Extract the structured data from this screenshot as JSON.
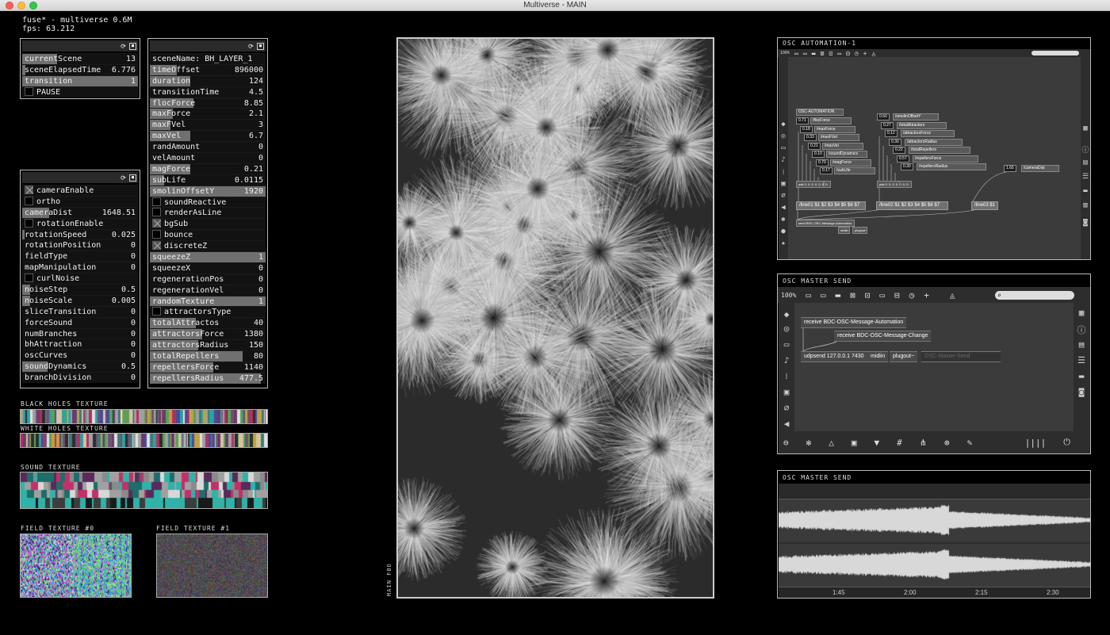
{
  "window": {
    "title": "Multiverse - MAIN"
  },
  "info": {
    "line1": "fuse* - multiverse 0.6M",
    "line2": "fps: 63.212"
  },
  "panel_scene": {
    "rows": [
      {
        "label": "currentScene",
        "value": "13",
        "fill": 0.3
      },
      {
        "label": "sceneElapsedTime",
        "value": "6.776",
        "fill": 0.03
      },
      {
        "label": "transition",
        "value": "1",
        "fill": 1.0
      }
    ],
    "toggle_pause": {
      "label": "PAUSE",
      "on": false
    }
  },
  "panel_layer": {
    "scene_name": "sceneName: BH_LAYER_1",
    "rows": [
      {
        "type": "slider",
        "label": "timeOffset",
        "value": "896000",
        "fill": 0.23
      },
      {
        "type": "slider",
        "label": "duration",
        "value": "124",
        "fill": 0.35
      },
      {
        "type": "slider",
        "label": "transitionTime",
        "value": "4.5",
        "fill": 0.0
      },
      {
        "type": "slider",
        "label": "flocForce",
        "value": "8.85",
        "fill": 0.38
      },
      {
        "type": "slider",
        "label": "maxForce",
        "value": "2.1",
        "fill": 0.2
      },
      {
        "type": "slider",
        "label": "maxFVel",
        "value": "3",
        "fill": 0.18
      },
      {
        "type": "slider",
        "label": "maxVel",
        "value": "6.7",
        "fill": 0.35
      },
      {
        "type": "slider",
        "label": "randAmount",
        "value": "0",
        "fill": 0.0
      },
      {
        "type": "slider",
        "label": "velAmount",
        "value": "0",
        "fill": 0.0
      },
      {
        "type": "slider",
        "label": "magForce",
        "value": "0.21",
        "fill": 0.35
      },
      {
        "type": "slider",
        "label": "subLife",
        "value": "0.0115",
        "fill": 0.12
      },
      {
        "type": "slider",
        "label": "smolinOffsetY",
        "value": "1920",
        "fill": 1.0
      },
      {
        "type": "toggle",
        "label": "soundReactive",
        "on": false
      },
      {
        "type": "toggle",
        "label": "renderAsLine",
        "on": false
      },
      {
        "type": "toggle",
        "label": "bgSub",
        "on": true
      },
      {
        "type": "toggle",
        "label": "bounce",
        "on": false
      },
      {
        "type": "toggle",
        "label": "discreteZ",
        "on": true
      },
      {
        "type": "slider",
        "label": "squeezeZ",
        "value": "1",
        "fill": 1.0
      },
      {
        "type": "slider",
        "label": "squeezeX",
        "value": "0",
        "fill": 0.0
      },
      {
        "type": "slider",
        "label": "regenerationPos",
        "value": "0",
        "fill": 0.0
      },
      {
        "type": "slider",
        "label": "regenerationVel",
        "value": "0",
        "fill": 0.0
      },
      {
        "type": "slider",
        "label": "randomTexture",
        "value": "1",
        "fill": 1.0
      },
      {
        "type": "toggle",
        "label": "attractorsType",
        "on": false
      },
      {
        "type": "slider",
        "label": "totalAttractos",
        "value": "40",
        "fill": 0.4
      },
      {
        "type": "slider",
        "label": "attractorsForce",
        "value": "1380",
        "fill": 0.45
      },
      {
        "type": "slider",
        "label": "attractorsRadius",
        "value": "150",
        "fill": 0.42
      },
      {
        "type": "slider",
        "label": "totalRepellers",
        "value": "80",
        "fill": 0.8
      },
      {
        "type": "slider",
        "label": "repellersForce",
        "value": "1140",
        "fill": 0.55
      },
      {
        "type": "slider",
        "label": "repellersRadius",
        "value": "477.5",
        "fill": 0.96
      }
    ]
  },
  "panel_camera": {
    "rows": [
      {
        "type": "toggle",
        "label": "cameraEnable",
        "on": true
      },
      {
        "type": "toggle",
        "label": "ortho",
        "on": false
      },
      {
        "type": "slider",
        "label": "cameraDist",
        "value": "1648.51",
        "fill": 0.23
      },
      {
        "type": "toggle",
        "label": "rotationEnable",
        "on": false
      },
      {
        "type": "slider",
        "label": "rotationSpeed",
        "value": "0.025",
        "fill": 0.02
      },
      {
        "type": "slider",
        "label": "rotationPosition",
        "value": "0",
        "fill": 0.0
      },
      {
        "type": "slider",
        "label": "fieldType",
        "value": "0",
        "fill": 0.0
      },
      {
        "type": "slider",
        "label": "mapManipulation",
        "value": "0",
        "fill": 0.0
      },
      {
        "type": "toggle",
        "label": "curlNoise",
        "on": false
      },
      {
        "type": "slider",
        "label": "noiseStep",
        "value": "0.5",
        "fill": 0.07
      },
      {
        "type": "slider",
        "label": "noiseScale",
        "value": "0.005",
        "fill": 0.07
      },
      {
        "type": "slider",
        "label": "sliceTransition",
        "value": "0",
        "fill": 0.0
      },
      {
        "type": "slider",
        "label": "forceSound",
        "value": "0",
        "fill": 0.0
      },
      {
        "type": "slider",
        "label": "numBranches",
        "value": "0",
        "fill": 0.0
      },
      {
        "type": "slider",
        "label": "bhAttraction",
        "value": "0",
        "fill": 0.0
      },
      {
        "type": "slider",
        "label": "oscCurves",
        "value": "0",
        "fill": 0.0
      },
      {
        "type": "slider",
        "label": "soundDynamics",
        "value": "0.5",
        "fill": 0.22
      },
      {
        "type": "slider",
        "label": "branchDivision",
        "value": "0",
        "fill": 0.0
      }
    ]
  },
  "textures": {
    "black_holes": "BLACK HOLES TEXTURE",
    "white_holes": "WHITE HOLES TEXTURE",
    "sound": "SOUND TEXTURE",
    "field0": "FIELD TEXTURE #0",
    "field1": "FIELD TEXTURE #1"
  },
  "main_fbo": {
    "label": "MAIN FBO"
  },
  "osc_automation": {
    "title": "OSC AUTOMATION-1",
    "zoom": "100%",
    "header_obj": "OSC-AUTOMATION",
    "left_params": [
      {
        "num": "0.71",
        "name": "/flocForce"
      },
      {
        "num": "0.18",
        "name": "/maxForce"
      },
      {
        "num": "0.33",
        "name": "/maxFVel"
      },
      {
        "num": "0.21",
        "name": "/maxVel"
      },
      {
        "num": "0.10",
        "name": "/soundDynamics"
      },
      {
        "num": "0.70",
        "name": "/magForce"
      },
      {
        "num": "0.17",
        "name": "/subLife"
      }
    ],
    "right_params": [
      {
        "num": "0.50",
        "name": "/smolinOffsetY"
      },
      {
        "num": "0.27",
        "name": "/totalAttractors"
      },
      {
        "num": "0.12",
        "name": "/attractorsForce"
      },
      {
        "num": "0.30",
        "name": "/attractorsRadius"
      },
      {
        "num": "0.22",
        "name": "/totalRepellers"
      },
      {
        "num": "0.57",
        "name": "/repellersForce"
      },
      {
        "num": "0.30",
        "name": "/repellersRadius"
      }
    ],
    "camera_num": "1.65",
    "camera_name": "/cameraDist",
    "pak1": "pak 0. 0. 0. 0. 0. 0. 0.",
    "pak2": "pak 0. 0. 0. 0. 0. 0. 0.",
    "line1": "/line01 $1 $2 $3 $4 $5 $6 $7",
    "line2": "/line02 $1 $2 $3 $4 $5 $6 $7",
    "line3": "/line03 $1",
    "send": "send BDC-OSC-Message-Automation",
    "midiin": "midiin",
    "plugout": "plugout~"
  },
  "osc_master": {
    "title": "OSC MASTER SEND",
    "zoom": "100%",
    "receive1": "receive BDC-OSC-Message-Automation",
    "receive2": "receive BDC-OSC-Message-Change",
    "udpsend": "udpsend 127.0.0.1 7430",
    "midiin": "midiin",
    "plugout": "plugout~",
    "comment": "OSC-Master-Send"
  },
  "osc_wave": {
    "title": "OSC MASTER SEND",
    "timeline": [
      "1:45",
      "2:00",
      "2:15",
      "2:30"
    ]
  }
}
